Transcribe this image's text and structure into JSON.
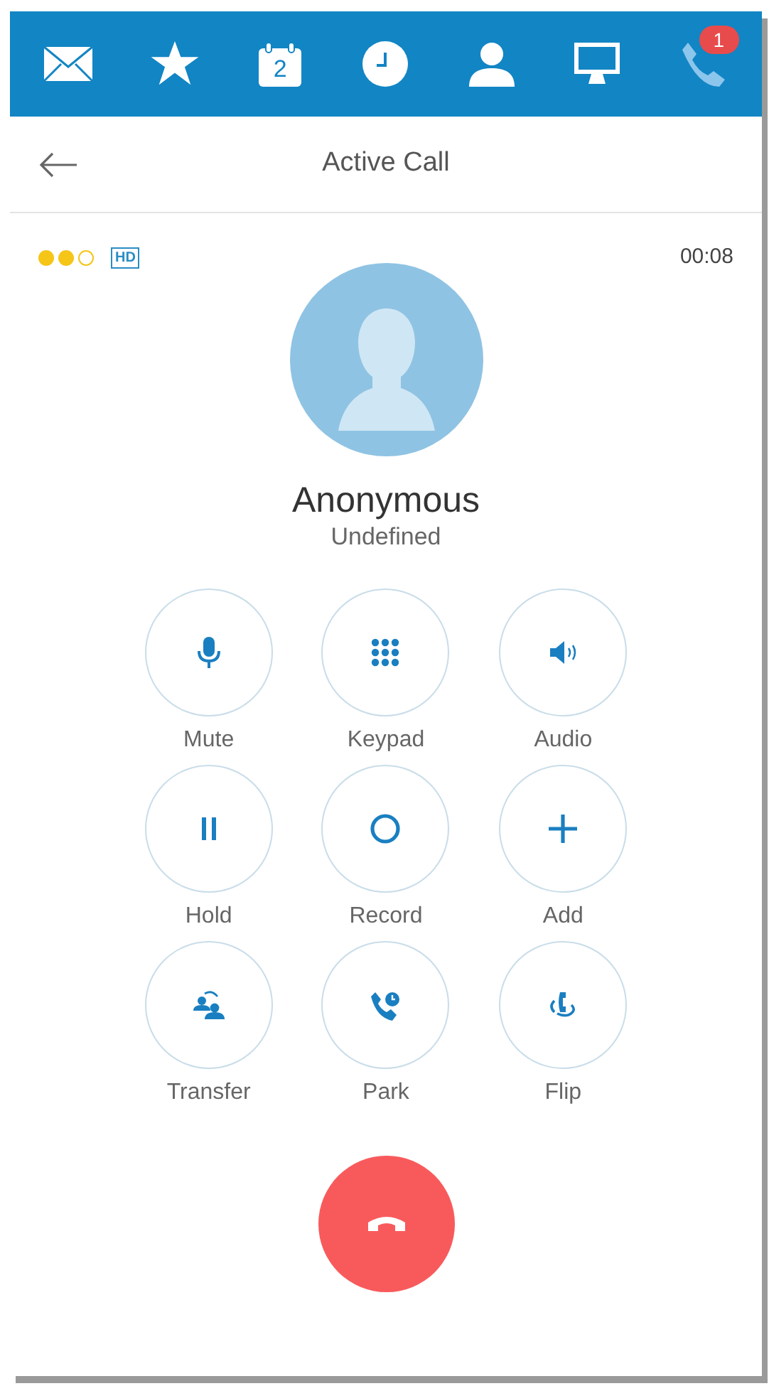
{
  "nav_tabs": [
    {
      "kind": "mail",
      "selected": false
    },
    {
      "kind": "star",
      "selected": false
    },
    {
      "kind": "calendar",
      "day": "2",
      "selected": false
    },
    {
      "kind": "clock",
      "selected": false
    },
    {
      "kind": "person",
      "selected": false
    },
    {
      "kind": "monitor",
      "selected": false
    },
    {
      "kind": "phone",
      "badge": "1",
      "selected": true
    }
  ],
  "header": {
    "title": "Active Call"
  },
  "call_quality": [
    {
      "filled": true
    },
    {
      "filled": true
    },
    {
      "filled": false
    }
  ],
  "hd_badge": "HD",
  "duration": "00:08",
  "caller": {
    "name": "Anonymous",
    "subtitle": "Undefined"
  },
  "actions": [
    {
      "kind": "mic",
      "label": "Mute"
    },
    {
      "kind": "keypad",
      "label": "Keypad"
    },
    {
      "kind": "speaker",
      "label": "Audio"
    },
    {
      "kind": "pause",
      "label": "Hold"
    },
    {
      "kind": "record",
      "label": "Record"
    },
    {
      "kind": "plus",
      "label": "Add"
    },
    {
      "kind": "transfer",
      "label": "Transfer"
    },
    {
      "kind": "park",
      "label": "Park"
    },
    {
      "kind": "flip",
      "label": "Flip"
    }
  ]
}
